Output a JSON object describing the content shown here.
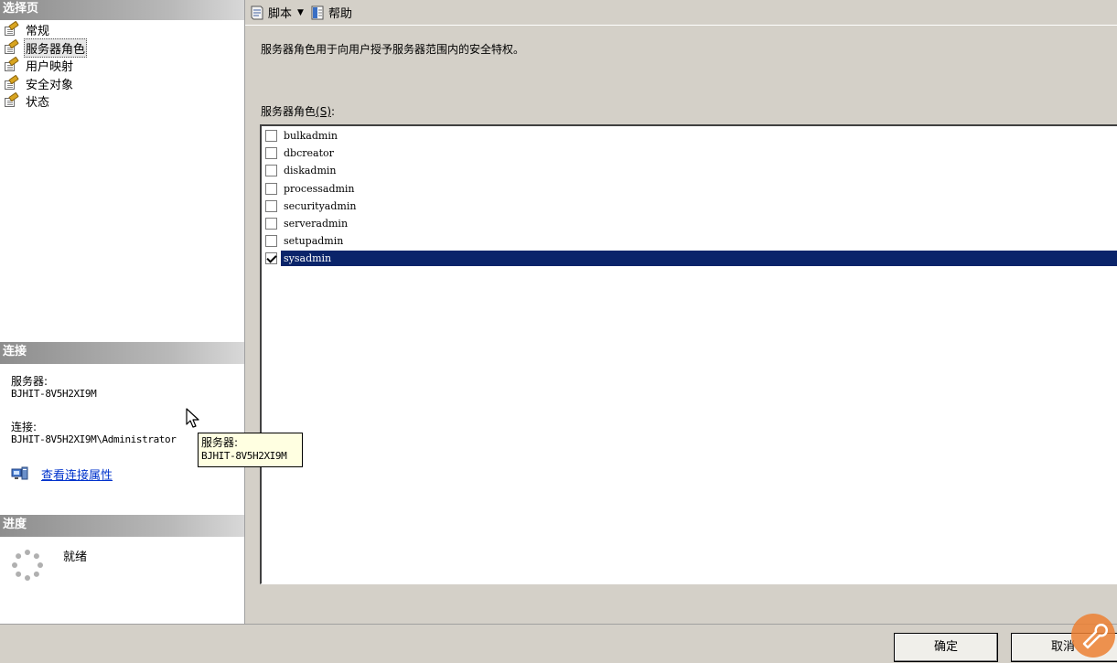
{
  "select_page": {
    "header": "选择页",
    "pages": [
      {
        "label": "常规",
        "selected": false
      },
      {
        "label": "服务器角色",
        "selected": true
      },
      {
        "label": "用户映射",
        "selected": false
      },
      {
        "label": "安全对象",
        "selected": false
      },
      {
        "label": "状态",
        "selected": false
      }
    ]
  },
  "connection": {
    "header": "连接",
    "server_label": "服务器:",
    "server_value": "BJHIT-8V5H2XI9M",
    "connection_label": "连接:",
    "connection_value": "BJHIT-8V5H2XI9M\\Administrator",
    "view_properties_link": "查看连接属性"
  },
  "progress": {
    "header": "进度",
    "status": "就绪"
  },
  "toolbar": {
    "script_label": "脚本",
    "help_label": "帮助"
  },
  "main": {
    "description": "服务器角色用于向用户授予服务器范围内的安全特权。",
    "roles_label": "服务器角色",
    "roles_label_accel": "(S)",
    "roles_label_suffix": ":",
    "roles": [
      {
        "name": "bulkadmin",
        "checked": false,
        "selected": false
      },
      {
        "name": "dbcreator",
        "checked": false,
        "selected": false
      },
      {
        "name": "diskadmin",
        "checked": false,
        "selected": false
      },
      {
        "name": "processadmin",
        "checked": false,
        "selected": false
      },
      {
        "name": "securityadmin",
        "checked": false,
        "selected": false
      },
      {
        "name": "serveradmin",
        "checked": false,
        "selected": false
      },
      {
        "name": "setupadmin",
        "checked": false,
        "selected": false
      },
      {
        "name": "sysadmin",
        "checked": true,
        "selected": true
      }
    ]
  },
  "buttons": {
    "ok": "确定",
    "cancel": "取消"
  },
  "tooltip": {
    "label": "服务器:",
    "value": "BJHIT-8V5H2XI9M"
  },
  "colors": {
    "selection": "#0a246a",
    "link": "#0033cc",
    "tooltip_bg": "#ffffe1"
  }
}
